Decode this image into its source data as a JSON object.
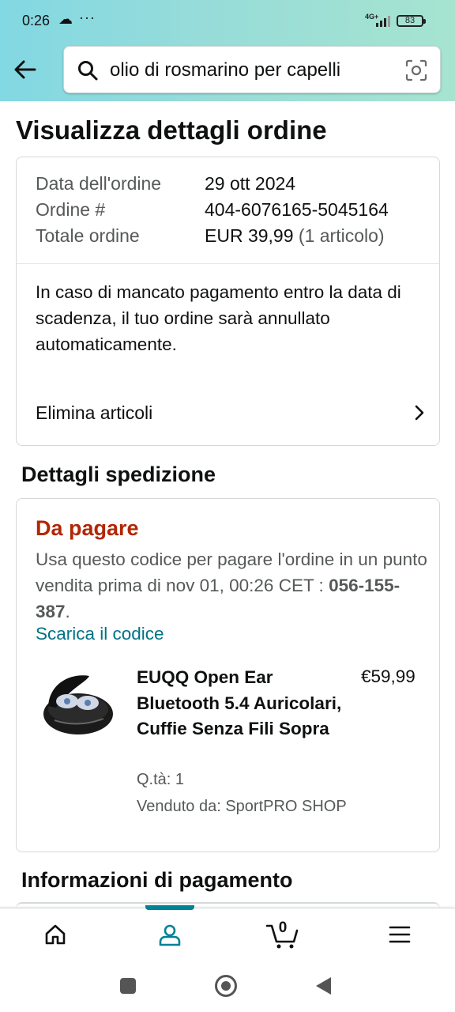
{
  "status_bar": {
    "time": "0:26",
    "network": "4G+",
    "battery": "83"
  },
  "search": {
    "query": "olio di rosmarino per capelli"
  },
  "page_title": "Visualizza dettagli ordine",
  "summary": {
    "rows": [
      {
        "label": "Data dell'ordine",
        "value": "29 ott 2024",
        "extra": ""
      },
      {
        "label": "Ordine #",
        "value": "404-6076165-5045164",
        "extra": ""
      },
      {
        "label": "Totale ordine",
        "value": "EUR 39,99",
        "extra": "(1 articolo)"
      }
    ],
    "warning": "In caso di mancato pagamento entro la data di scadenza, il tuo ordine sarà annullato automaticamente.",
    "delete_items": "Elimina articoli"
  },
  "shipping": {
    "section_title": "Dettagli spedizione",
    "status": "Da pagare",
    "instructions": "Usa questo codice per pagare l'ordine in un punto vendita prima di nov 01, 00:26 CET :",
    "code": "056-155-387",
    "code_suffix": ".",
    "download_link": "Scarica il codice",
    "product": {
      "title": "EUQQ Open Ear Bluetooth 5.4 Auricolari, Cuffie Senza Fili Sopra",
      "price": "€59,99",
      "quantity": "Q.tà: 1",
      "seller": "Venduto da: SportPRO SHOP"
    }
  },
  "payment": {
    "section_title": "Informazioni di pagamento"
  },
  "bottom_nav": {
    "cart_count": "0"
  },
  "colors": {
    "accent": "#008296",
    "link": "#007185",
    "alert": "#b12704",
    "header_start": "#82d8e3",
    "header_end": "#a6e4d0"
  }
}
